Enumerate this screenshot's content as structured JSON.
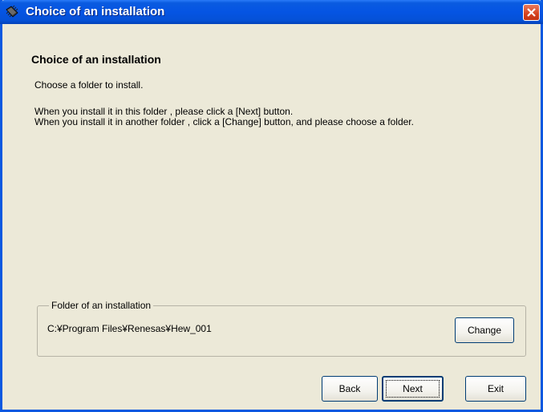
{
  "window": {
    "title": "Choice of an installation"
  },
  "content": {
    "heading": "Choice of an installation",
    "instruction": "Choose a folder to install.",
    "line1": "When you install it in this folder , please click a [Next] button.",
    "line2": "When you install it in another folder , click a [Change] button, and please choose a folder."
  },
  "folder_group": {
    "legend": "Folder of an installation",
    "path": "C:¥Program Files¥Renesas¥Hew_001",
    "change_label": "Change"
  },
  "buttons": {
    "back_label": "Back",
    "next_label": "Next",
    "exit_label": "Exit"
  },
  "colors": {
    "titlebar": "#0554E3",
    "dialog_bg": "#ECE9D8",
    "close_button": "#D5421E"
  }
}
